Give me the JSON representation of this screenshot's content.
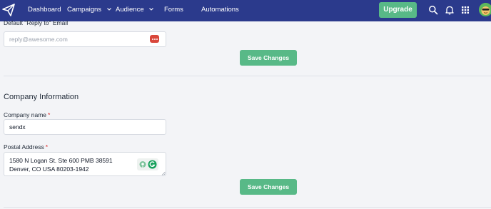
{
  "nav": {
    "items": [
      {
        "label": "Dashboard"
      },
      {
        "label": "Campaigns"
      },
      {
        "label": "Audience"
      },
      {
        "label": "Forms"
      },
      {
        "label": "Automations"
      }
    ],
    "upgrade_label": "Upgrade",
    "icons": [
      "send-logo-icon",
      "search-icon",
      "bell-icon",
      "apps-grid-icon",
      "avatar"
    ]
  },
  "reply_to": {
    "label": "Default \"Reply to\" Email",
    "placeholder": "reply@awesome.com",
    "save_label": "Save Changes"
  },
  "company": {
    "title": "Company Information",
    "name_label": "Company name",
    "name_value": "sendx",
    "required_mark": "*",
    "address_label": "Postal Address",
    "address_line1": "1580 N Logan St. Ste 600 PMB 38591",
    "address_line2": "Denver, CO USA 80203-1942",
    "save_label": "Save Changes"
  },
  "colors": {
    "nav_bg": "#2b3a8c",
    "accent_green": "#58b987",
    "required_red": "#dc2626",
    "page_bg": "#f3f4f7"
  }
}
